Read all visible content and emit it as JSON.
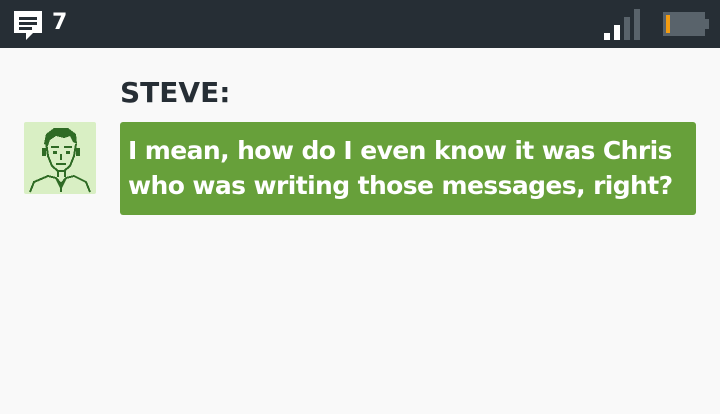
{
  "status_bar": {
    "message_count": "7",
    "icons": {
      "messages": "chat-bubble-icon",
      "signal": "signal-strength-icon",
      "battery": "battery-low-icon"
    },
    "colors": {
      "background": "#262e35",
      "battery_level": "#f39c12"
    },
    "signal_bars_active": 2,
    "signal_bars_total": 4,
    "battery_level": 0.1
  },
  "chat": {
    "speaker": "STEVE:",
    "avatar": "steve-avatar-icon",
    "message": "I mean, how do I even know it was Chris who was writing those messages, right?",
    "colors": {
      "bubble": "#67a03a",
      "avatar_bg": "#d9efc4"
    }
  }
}
